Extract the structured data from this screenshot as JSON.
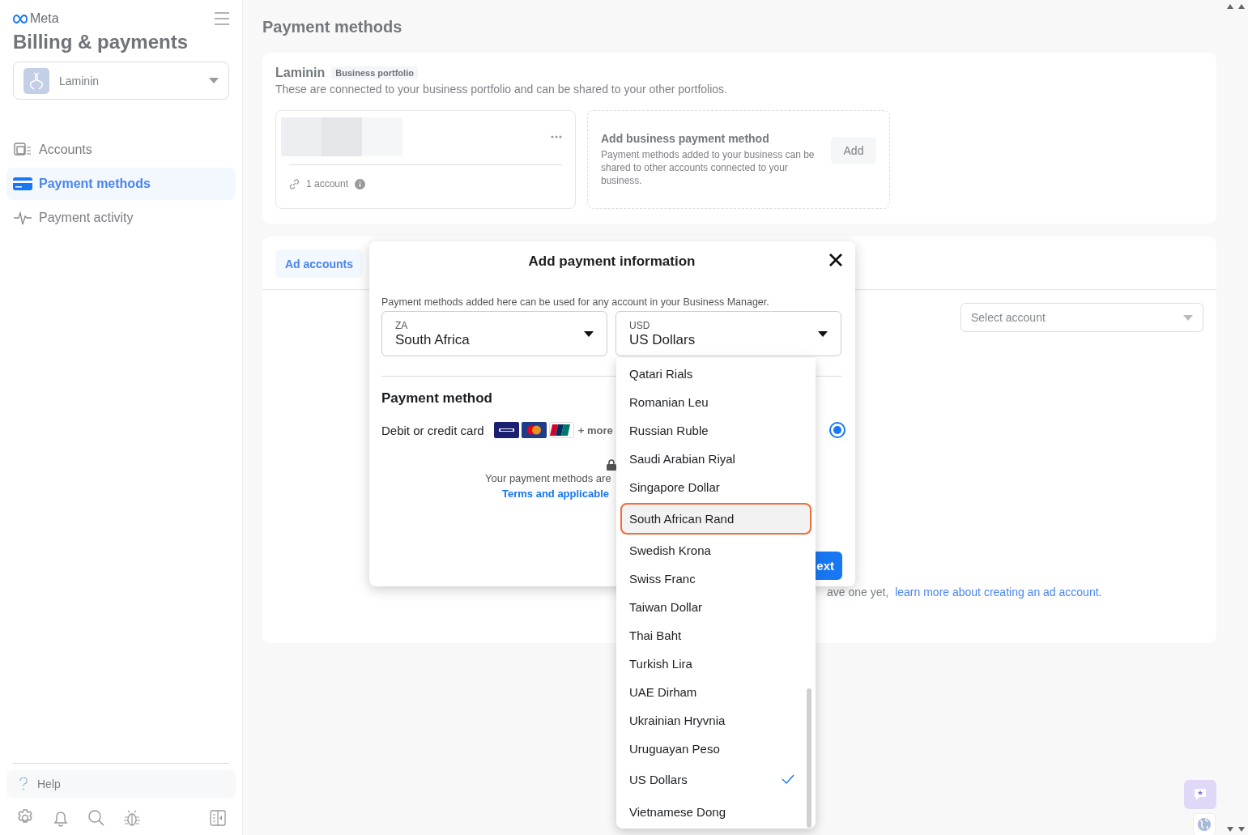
{
  "sidebar": {
    "brand": "Meta",
    "title": "Billing & payments",
    "account": {
      "name": "Laminin"
    },
    "nav": [
      {
        "label": "Accounts",
        "kind": "accounts",
        "selected": false
      },
      {
        "label": "Payment methods",
        "kind": "card",
        "selected": true
      },
      {
        "label": "Payment activity",
        "kind": "activity",
        "selected": false
      }
    ],
    "help": "Help",
    "tools": [
      {
        "kind": "settings"
      },
      {
        "kind": "notifications"
      },
      {
        "kind": "search"
      },
      {
        "kind": "bug"
      },
      {
        "kind": "panel"
      }
    ]
  },
  "page": {
    "title": "Payment methods"
  },
  "portfolio": {
    "name": "Laminin",
    "badge": "Business portfolio",
    "description": "These are connected to your business portfolio and can be shared to your other portfolios.",
    "payment_card": {
      "accounts": "1 account"
    },
    "add_method": {
      "title": "Add business payment method",
      "description": "Payment methods added to your business can be shared to other accounts connected to your business.",
      "button": "Add"
    }
  },
  "ad_accounts": {
    "tabs": [
      {
        "label": "Ad accounts",
        "selected": true
      }
    ],
    "select": {
      "placeholder": "Select account"
    },
    "hint": "ave one yet,",
    "link": "learn more about creating an ad account."
  },
  "dialog": {
    "title": "Add payment information",
    "description": "Payment methods added here can be used for any account in your Business Manager.",
    "country": {
      "label": "ZA",
      "value": "South Africa"
    },
    "currency": {
      "label": "USD",
      "value": "US Dollars"
    },
    "section": "Payment method",
    "methods": [
      {
        "label": "Debit or credit card",
        "more": "+ more",
        "selected": true
      }
    ],
    "secure_note": "Your payment methods are",
    "terms_link": "Terms and applicable",
    "next_button": "ext"
  },
  "currency_options": [
    {
      "label": "Qatari Rials",
      "selected": false,
      "highlighted": false
    },
    {
      "label": "Romanian Leu",
      "selected": false,
      "highlighted": false
    },
    {
      "label": "Russian Ruble",
      "selected": false,
      "highlighted": false
    },
    {
      "label": "Saudi Arabian Riyal",
      "selected": false,
      "highlighted": false
    },
    {
      "label": "Singapore Dollar",
      "selected": false,
      "highlighted": false
    },
    {
      "label": "South African Rand",
      "selected": false,
      "highlighted": true
    },
    {
      "label": "Swedish Krona",
      "selected": false,
      "highlighted": false
    },
    {
      "label": "Swiss Franc",
      "selected": false,
      "highlighted": false
    },
    {
      "label": "Taiwan Dollar",
      "selected": false,
      "highlighted": false
    },
    {
      "label": "Thai Baht",
      "selected": false,
      "highlighted": false
    },
    {
      "label": "Turkish Lira",
      "selected": false,
      "highlighted": false
    },
    {
      "label": "UAE Dirham",
      "selected": false,
      "highlighted": false
    },
    {
      "label": "Ukrainian Hryvnia",
      "selected": false,
      "highlighted": false
    },
    {
      "label": "Uruguayan Peso",
      "selected": false,
      "highlighted": false
    },
    {
      "label": "US Dollars",
      "selected": true,
      "highlighted": false
    },
    {
      "label": "Vietnamese Dong",
      "selected": false,
      "highlighted": false
    }
  ]
}
